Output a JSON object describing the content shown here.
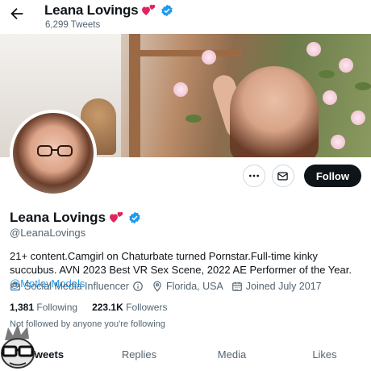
{
  "header": {
    "name": "Leana Lovings",
    "tweet_count": "6,299 Tweets",
    "verified_color": "#1d9bf0"
  },
  "banner": {
    "description_icon": "banner-photo"
  },
  "actions": {
    "more_icon": "more-icon",
    "message_icon": "envelope-icon",
    "follow_label": "Follow"
  },
  "profile": {
    "name": "Leana Lovings",
    "handle": "@LeanaLovings",
    "bio_text": "21+ content.Camgirl on Chaturbate turned Pornstar.Full-time kinky succubus. AVN 2023 Best VR Sex Scene, 2022 AE Performer of the Year.",
    "bio_mention": "@MotleyModels",
    "category": "Social Media Influencer",
    "location": "Florida, USA",
    "joined": "Joined July 2017",
    "following_count": "1,381",
    "following_label": "Following",
    "followers_count": "223.1K",
    "followers_label": "Followers",
    "not_followed": "Not followed by anyone you're following"
  },
  "tabs": [
    {
      "label": "Tweets"
    },
    {
      "label": "Replies"
    },
    {
      "label": "Media"
    },
    {
      "label": "Likes"
    }
  ]
}
